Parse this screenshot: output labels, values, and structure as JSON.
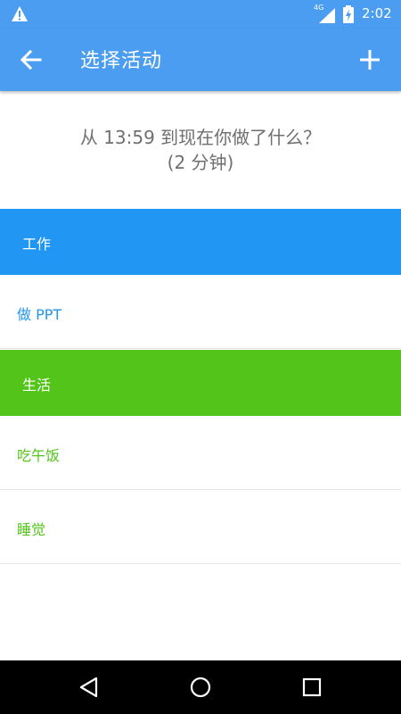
{
  "status_bar": {
    "time": "2:02",
    "network": "4G",
    "icons": [
      "warning-icon",
      "signal-icon",
      "battery-charging-icon"
    ]
  },
  "toolbar": {
    "title": "选择活动",
    "back_icon": "arrow-left-icon",
    "add_icon": "plus-icon"
  },
  "question": {
    "line1": "从 13:59 到现在你做了什么？",
    "line2": "(2 分钟)"
  },
  "categories": [
    {
      "label": "工作",
      "color": "#2196f3",
      "items": [
        {
          "label": "做 PPT"
        }
      ]
    },
    {
      "label": "生活",
      "color": "#52c41a",
      "items": [
        {
          "label": "吃午饭"
        },
        {
          "label": "睡觉"
        }
      ]
    }
  ],
  "colors": {
    "toolbar": "#4a9df0",
    "work": "#2196f3",
    "life": "#52c41a",
    "question_text": "#6f6f6f"
  },
  "nav_bar": {
    "icons": [
      "back-triangle-icon",
      "home-circle-icon",
      "recents-square-icon"
    ]
  }
}
